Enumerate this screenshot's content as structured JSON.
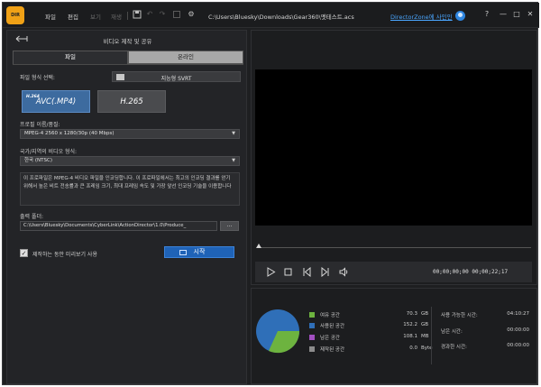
{
  "titlebar": {
    "app_logo_text": "DIR",
    "menu": [
      "파일",
      "편집",
      "보기",
      "재생"
    ],
    "file_path": "C:\\Users\\Bluesky\\Downloads\\Gear360\\멧테스트.acs",
    "signin": "DirectorZone에 사인인",
    "help": "?",
    "minimize": "—",
    "maximize": "□",
    "close": "✕"
  },
  "panel": {
    "title": "비디오 제작 및 공유",
    "tabs": {
      "file": "파일",
      "online": "온라인"
    }
  },
  "form": {
    "file_format_label": "파일 형식 선택:",
    "svrt_label": "지능형 SVRT",
    "format_avc_sup": "H.264",
    "format_avc": "AVC(.MP4)",
    "format_hevc": "H.265",
    "profile_label": "프로필 이름/품질:",
    "profile_value": "MPEG-4 2560 x 1280/30p (40 Mbps)",
    "country_label": "국가/지역의 비디오 형식:",
    "country_value": "한국 (NTSC)",
    "description": "이 프로파일은 MPEG-4 비디오 파일을 인코딩합니다. 이 프로파일에서는 최고의 인코딩 결과를 얻기 위해서 높은 비트 전송률과 큰 프레임 크기, 최대 프레임 속도 및 가장 앞선 인코딩 기술을 이용합니다",
    "output_label": "출력 폴더:",
    "output_path": "C:\\Users\\Bluesky\\Documents\\CyberLink\\ActionDirector\\1.0\\Produce_",
    "browse": "...",
    "preview_label": "제작하는 동안 미리보기 사용",
    "preview_checked": true,
    "start": "시작"
  },
  "player": {
    "timecode": "00;00;00;00 00;00;22;17",
    "position_fraction": 0.0
  },
  "storage": {
    "legend": [
      {
        "label": "여유 공간",
        "value": "70.3",
        "unit": "GB",
        "color": "#6db33f"
      },
      {
        "label": "사용된 공간",
        "value": "152.2",
        "unit": "GB",
        "color": "#2f6fb8"
      },
      {
        "label": "남은 공간",
        "value": "108.1",
        "unit": "MB",
        "color": "#a24fc1"
      },
      {
        "label": "제작된 공간",
        "value": "0.0",
        "unit": "Byte",
        "color": "#8c8c8c"
      }
    ],
    "times": [
      {
        "label": "사용 가능한 시간:",
        "value": "04:10:27"
      },
      {
        "label": "남은 시간:",
        "value": "00:00:00"
      },
      {
        "label": "경과한 시간:",
        "value": "00:00:00"
      }
    ]
  }
}
